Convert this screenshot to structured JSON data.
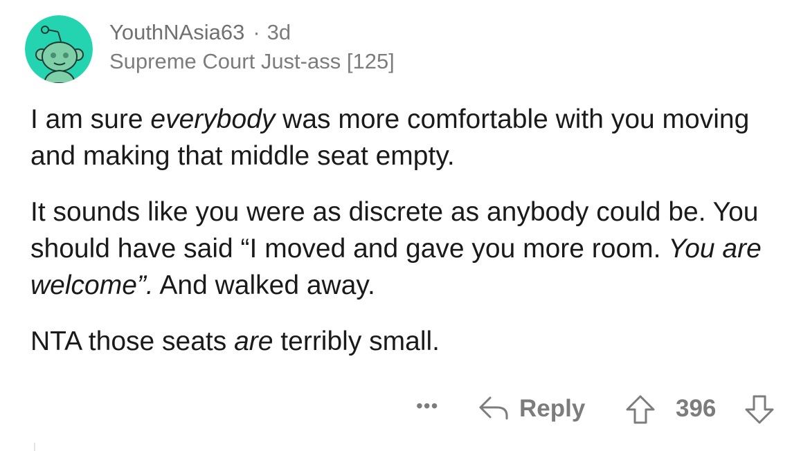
{
  "comment": {
    "username": "YouthNAsia63",
    "separator": "·",
    "age": "3d",
    "flair": "Supreme Court Just-ass [125]",
    "avatar_icon": "reddit-snoo-avatar-icon",
    "avatar_color": "#24d4b0",
    "paragraphs": [
      {
        "p1_a": "I am sure ",
        "p1_em": "everybody",
        "p1_b": " was more comfortable with you moving and making that middle seat empty."
      },
      {
        "p2_a": "It sounds like you were as discrete as anybody could be. You should have said “I moved and gave you more room. ",
        "p2_em": "You are welcome”.",
        "p2_b": " And walked away."
      },
      {
        "p3_a": "NTA those seats ",
        "p3_em": "are",
        "p3_b": " terribly small."
      }
    ]
  },
  "actions": {
    "more_label": "•••",
    "reply_label": "Reply",
    "score": "396",
    "reply_icon": "reply-arrow-icon",
    "upvote_icon": "upvote-arrow-icon",
    "downvote_icon": "downvote-arrow-icon"
  },
  "colors": {
    "text": "#1a1a1b",
    "meta": "#7c7c7c",
    "avatar_bg": "#24d4b0"
  }
}
